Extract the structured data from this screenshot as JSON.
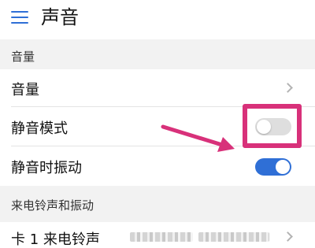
{
  "header": {
    "menu_icon": "menu-icon",
    "title": "声音"
  },
  "sections": [
    {
      "title": "音量"
    },
    {
      "title": "来电铃声和振动"
    }
  ],
  "rows": {
    "volume": {
      "label": "音量"
    },
    "silent_mode": {
      "label": "静音模式",
      "state": "off"
    },
    "vibrate_when_silent": {
      "label": "静音时振动",
      "state": "on"
    },
    "sim1_ringtone": {
      "label": "卡 1 来电铃声",
      "value_obscured": true
    }
  },
  "annotation": {
    "color": "#d8317a",
    "arrow": "pointing to silent-mode toggle"
  },
  "colors": {
    "accent": "#2f6fd6",
    "section_background": "#f2f2f2",
    "toggle_off": "#dedede"
  }
}
